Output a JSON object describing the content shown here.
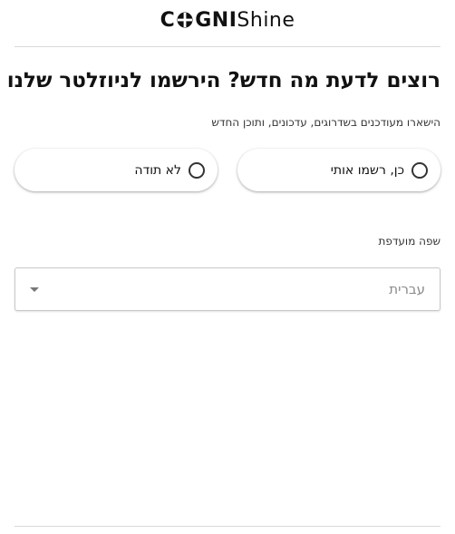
{
  "brand": {
    "logo_bold_left": "C",
    "logo_bold_right": "GNI",
    "logo_light": "Shine"
  },
  "newsletter": {
    "title": "רוצים לדעת מה חדש? הירשמו לניוזלטר שלנו",
    "subtitle": "הישארו מעודכנים בשדרוגים, עדכונים, ותוכן החדש",
    "options": [
      {
        "label": "כן, רשמו אותי",
        "selected": false
      },
      {
        "label": "לא תודה",
        "selected": false
      }
    ],
    "language_label": "שפה מועדפת",
    "language_value": "עברית"
  },
  "colors": {
    "text": "#111111",
    "divider": "#d9d9d9",
    "placeholder": "#8a8a8a"
  },
  "icons": {
    "radio": "radio-unchecked-icon",
    "caret": "chevron-down-icon",
    "logo_mark": "crosshair-o-icon"
  }
}
